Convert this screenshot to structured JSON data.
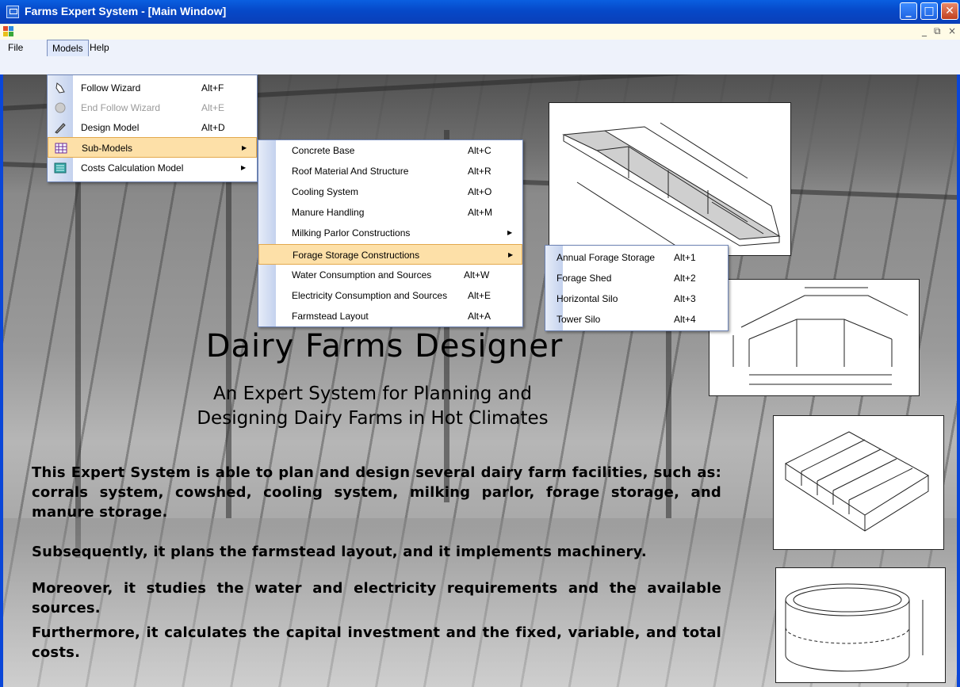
{
  "window": {
    "title": "Farms Expert System - [Main Window]"
  },
  "menubar": {
    "file": "File",
    "models": "Models",
    "help": "Help"
  },
  "models_menu": [
    {
      "label": "Follow  Wizard",
      "shortcut": "Alt+F",
      "icon": "wizard-hand-icon",
      "disabled": false
    },
    {
      "label": "End Follow  Wizard",
      "shortcut": "Alt+E",
      "icon": "wizard-stop-icon",
      "disabled": true
    },
    {
      "label": "Design Model",
      "shortcut": "Alt+D",
      "icon": "design-pencil-icon",
      "disabled": false
    },
    {
      "label": "Sub-Models",
      "shortcut": "",
      "icon": "grid-table-icon",
      "disabled": false
    },
    {
      "label": "Costs Calculation Model",
      "shortcut": "",
      "icon": "calculator-icon",
      "disabled": false
    }
  ],
  "submodels_menu": [
    {
      "label": "Concrete Base",
      "shortcut": "Alt+C"
    },
    {
      "label": "Roof Material And Structure",
      "shortcut": "Alt+R"
    },
    {
      "label": "Cooling System",
      "shortcut": "Alt+O"
    },
    {
      "label": "Manure Handling",
      "shortcut": "Alt+M"
    },
    {
      "label": "Milking Parlor Constructions",
      "shortcut": ""
    },
    {
      "label": "Forage Storage Constructions",
      "shortcut": ""
    },
    {
      "label": "Water Consumption and Sources",
      "shortcut": "Alt+W"
    },
    {
      "label": "Electricity Consumption and Sources",
      "shortcut": "Alt+E"
    },
    {
      "label": "Farmstead Layout",
      "shortcut": "Alt+A"
    }
  ],
  "forage_menu": [
    {
      "label": "Annual Forage Storage",
      "shortcut": "Alt+1"
    },
    {
      "label": "Forage Shed",
      "shortcut": "Alt+2"
    },
    {
      "label": "Horizontal Silo",
      "shortcut": "Alt+3"
    },
    {
      "label": "Tower Silo",
      "shortcut": "Alt+4"
    }
  ],
  "content": {
    "title": "Dairy Farms Designer",
    "subtitle_line1": "An Expert System for Planning and",
    "subtitle_line2": "Designing Dairy Farms in Hot Climates",
    "para1": "This Expert System is able to plan and design several dairy farm facilities, such as: corrals system, cowshed, cooling system, milking parlor, forage storage, and manure storage.",
    "para2": "Subsequently, it plans the farmstead layout, and it implements machinery.",
    "para3": "Moreover, it studies the water and electricity requirements and the available sources.",
    "para4": "Furthermore, it calculates the capital investment and the fixed, variable, and total costs."
  },
  "colors": {
    "titlebar": "#0648c8",
    "menu_highlight": "#fde0a8",
    "menu_highlight_border": "#e3a94e"
  }
}
